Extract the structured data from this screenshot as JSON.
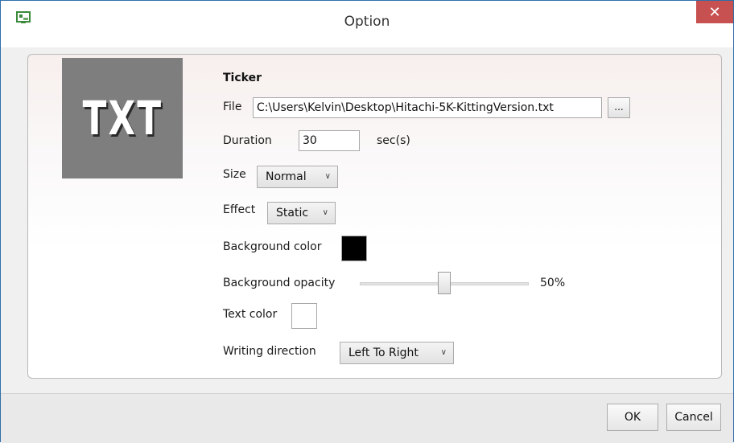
{
  "window": {
    "title": "Option",
    "close_glyph": "✕",
    "accent_color": "#c75050"
  },
  "preview": {
    "thumbnail_text": "TXT",
    "background_color": "#7e7e7e"
  },
  "form": {
    "heading": "Ticker",
    "file_label": "File",
    "file_value": "C:\\Users\\Kelvin\\Desktop\\Hitachi-5K-KittingVersion.txt",
    "browse_label": "...",
    "duration_label": "Duration",
    "duration_value": "30",
    "duration_unit": "sec(s)",
    "size_label": "Size",
    "size_value": "Normal",
    "effect_label": "Effect",
    "effect_value": "Static",
    "bg_color_label": "Background color",
    "bg_color_value": "#000000",
    "bg_opacity_label": "Background opacity",
    "bg_opacity_value": 50,
    "bg_opacity_text": "50%",
    "text_color_label": "Text color",
    "text_color_value": "#ffffff",
    "writing_direction_label": "Writing direction",
    "writing_direction_value": "Left To Right"
  },
  "footer": {
    "ok_label": "OK",
    "cancel_label": "Cancel"
  }
}
